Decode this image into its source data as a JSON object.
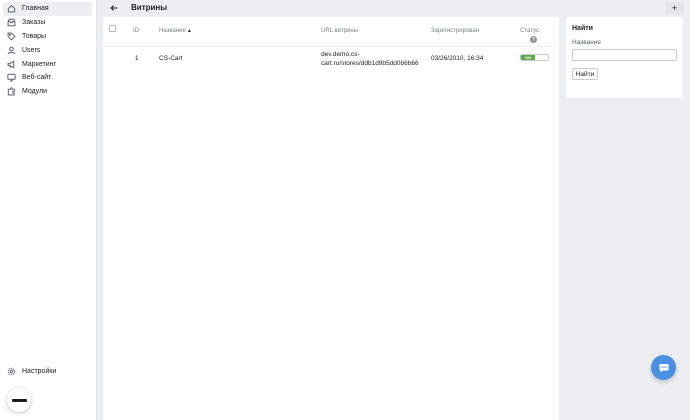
{
  "sidebar": {
    "items": [
      {
        "label": "Главная",
        "icon": "home-icon",
        "active": true
      },
      {
        "label": "Заказы",
        "icon": "inbox-icon"
      },
      {
        "label": "Товары",
        "icon": "tag-icon"
      },
      {
        "label": "Users",
        "icon": "user-icon"
      },
      {
        "label": "Маркетинг",
        "icon": "megaphone-icon"
      },
      {
        "label": "Веб-сайт",
        "icon": "monitor-icon"
      },
      {
        "label": "Модули",
        "icon": "puzzle-icon"
      }
    ],
    "settings_label": "Настройки"
  },
  "header": {
    "title": "Витрины",
    "add_label": "+"
  },
  "table": {
    "columns": {
      "id": "ID",
      "name": "Название",
      "url": "URL витрины",
      "registered": "Зарегистрирован",
      "status": "Статус"
    },
    "sort_indicator": "▲",
    "help": "?",
    "rows": [
      {
        "id": "1",
        "name": "CS-Cart",
        "url": "dev.demo.cs-cart.ru/stores/ddb1d9b5dd0b6b66",
        "registered": "03/26/2010, 16:34",
        "status": "ON"
      }
    ]
  },
  "filter": {
    "title": "Найти",
    "name_label": "Название",
    "name_value": "",
    "search_button": "Найти"
  },
  "colors": {
    "accent": "#4a90e2",
    "status_on": "#5fa84e"
  }
}
